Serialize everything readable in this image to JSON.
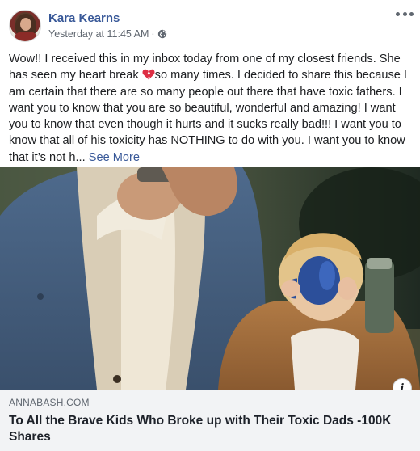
{
  "post": {
    "author": "Kara Kearns",
    "timestamp": "Yesterday at 11:45 AM",
    "separator": "·",
    "privacy_icon": "globe-icon",
    "more_icon": "more-options-icon",
    "text_before_emoji": "Wow!! I received this in my inbox today from one of my closest friends. She has seen my heart break ",
    "emoji": "broken-heart-icon",
    "text_after_emoji": "so many times. I decided to share this because I am certain that there are so many people out there that have toxic fathers. I want you to know that you are so beautiful, wonderful and amazing! I want you to know that even though it hurts and it sucks really bad!!! I want you to know that all of his toxicity has NOTHING to do with you. I want you to know that it’s not h...",
    "see_more": "See More"
  },
  "link": {
    "image_description_icon": "info-icon",
    "info_glyph": "i",
    "domain": "ANNABASH.COM",
    "title": "To All the Brave Kids Who Broke up with Their Toxic Dads -100K Shares"
  },
  "colors": {
    "link_blue": "#385898",
    "meta_gray": "#606770",
    "caption_bg": "#f2f3f5",
    "heart_red": "#dd2e44"
  }
}
